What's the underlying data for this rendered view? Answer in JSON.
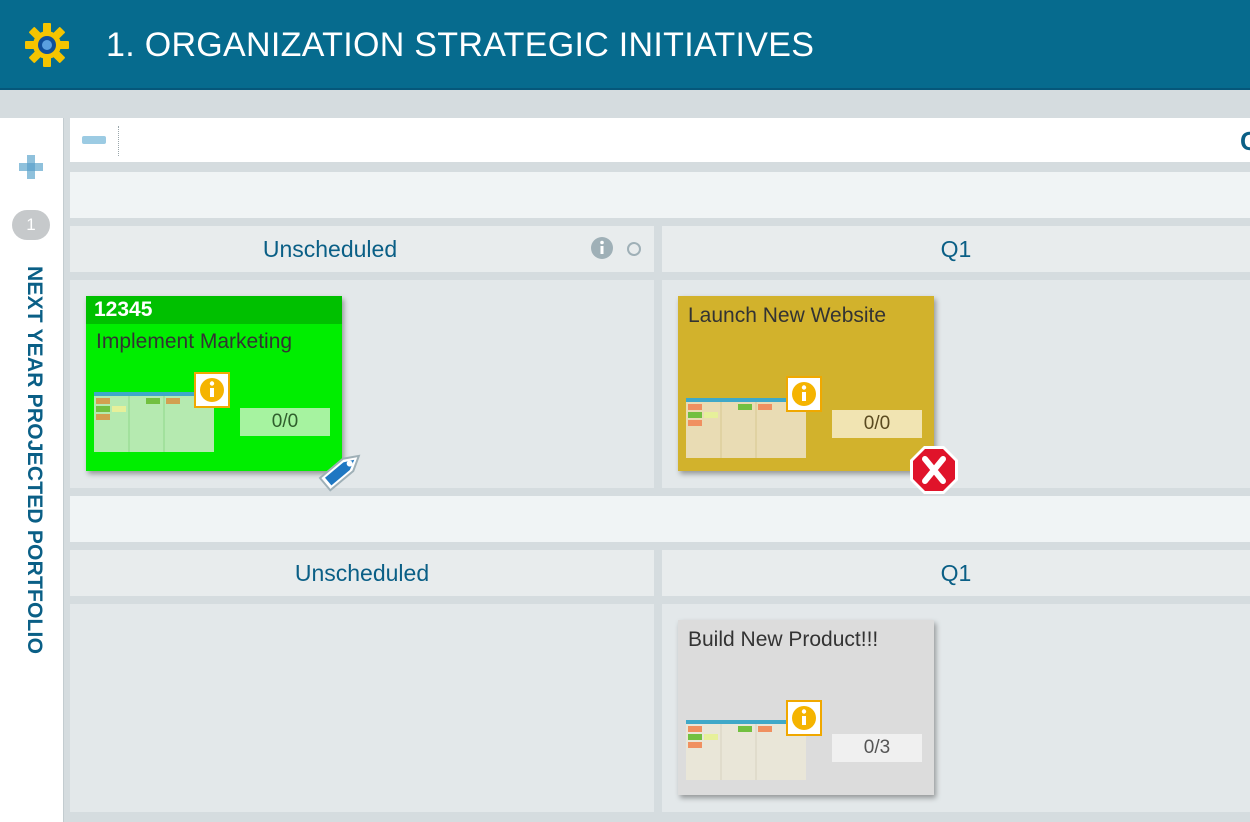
{
  "header": {
    "title": "1. ORGANIZATION STRATEGIC INITIATIVES",
    "logo_icon": "gear-logo-icon"
  },
  "sidebar": {
    "expand_icon": "plus-icon",
    "count": "1",
    "lane_label": "NEXT YEAR PROJECTED PORTFOLIO"
  },
  "toolbar": {
    "collapse_icon": "minus-icon",
    "cut_text": "C"
  },
  "lanes": [
    {
      "columns": [
        {
          "label": "Unscheduled"
        },
        {
          "label": "Q1"
        }
      ],
      "column_icons": [
        "info-icon",
        "circle-icon"
      ],
      "cards": [
        {
          "id": "12345",
          "title": "Implement Marketing",
          "progress": "0/0",
          "color": "#00ee00",
          "badge_icon": "tag-icon"
        },
        {
          "title": "Launch New Website",
          "progress": "0/0",
          "color": "#d2b22c",
          "badge_icon": "error-icon"
        }
      ]
    },
    {
      "columns": [
        {
          "label": "Unscheduled"
        },
        {
          "label": "Q1"
        }
      ],
      "cards": [
        {
          "title": "Build New Product!!!",
          "progress": "0/3",
          "color": "#dcdcdc"
        }
      ]
    }
  ],
  "colors": {
    "header": "#066b8e",
    "accent": "#0a5f86",
    "background": "#d5dcdf"
  }
}
